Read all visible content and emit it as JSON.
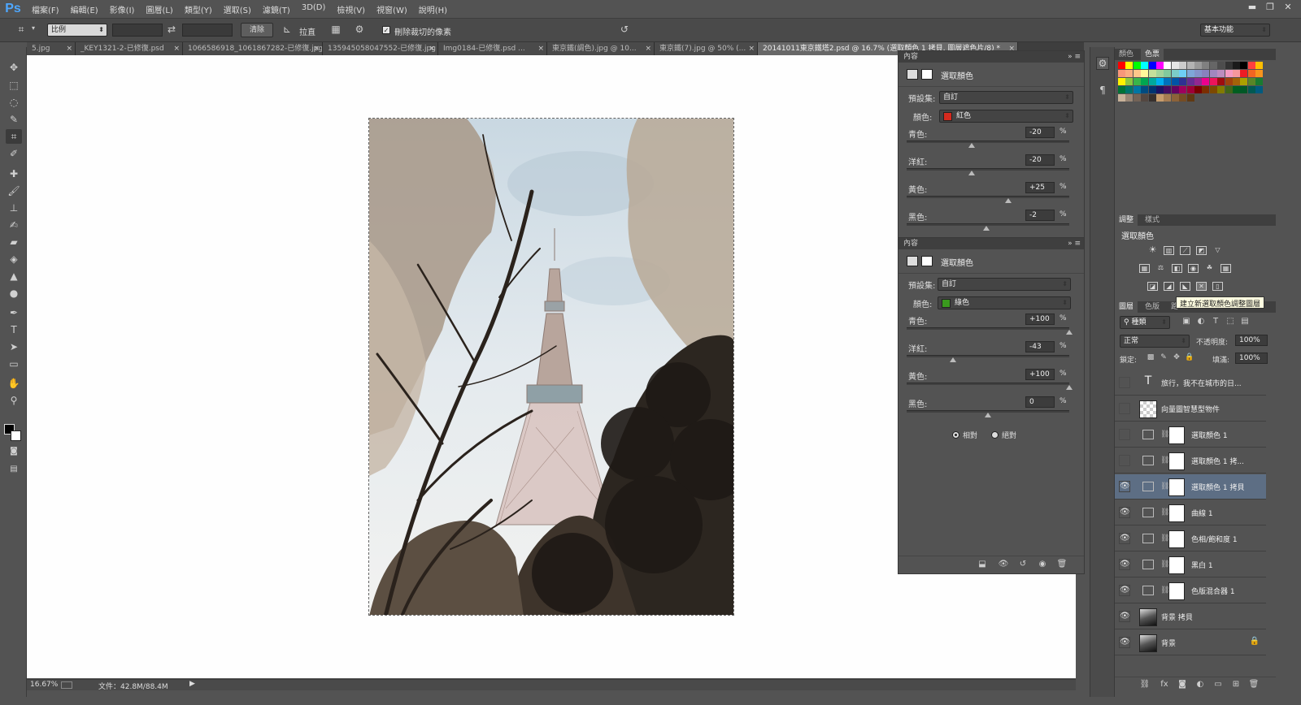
{
  "app": {
    "logo": "Ps"
  },
  "menu": [
    "檔案(F)",
    "編輯(E)",
    "影像(I)",
    "圖層(L)",
    "類型(Y)",
    "選取(S)",
    "濾鏡(T)",
    "3D(D)",
    "檢視(V)",
    "視窗(W)",
    "說明(H)"
  ],
  "window_controls": {
    "minimize": "▬",
    "restore": "❐",
    "close": "✕"
  },
  "options": {
    "ratio_select": "比例",
    "clear_button": "清除",
    "straighten_label": "拉直",
    "delete_cropped_label": "刪除裁切的像素",
    "delete_cropped_checked": "✓",
    "workspace": "基本功能"
  },
  "tabs": [
    {
      "label": "5.jpg"
    },
    {
      "label": "_KEY1321-2-已修復.psd"
    },
    {
      "label": "1066586918_1061867282-已修復.jpg"
    },
    {
      "label": "135945058047552-已修復.jpg"
    },
    {
      "label": "Img0184-已修復.psd ..."
    },
    {
      "label": "東京鐵(調色).jpg @ 10..."
    },
    {
      "label": "東京鐵(7).jpg @ 50% (..."
    },
    {
      "label": "20141011東京鐵塔2.psd @ 16.7% (選取顏色 1 拷貝, 圖層遮色片/8) *"
    }
  ],
  "tab_close": "×",
  "status": {
    "zoom": "16.67%",
    "doc": "文件：42.8M/88.4M"
  },
  "properties_top": {
    "header": "內容",
    "title": "選取顏色",
    "preset_label": "預設集:",
    "preset_value": "自訂",
    "colors_label": "顏色:",
    "colors_value": "紅色",
    "swatch_color": "#d42a1e",
    "sliders": [
      {
        "label": "青色:",
        "value": "-20",
        "unit": "%",
        "knob_pct": 0.4
      },
      {
        "label": "洋紅:",
        "value": "-20",
        "unit": "%",
        "knob_pct": 0.4
      },
      {
        "label": "黃色:",
        "value": "+25",
        "unit": "%",
        "knob_pct": 0.625
      },
      {
        "label": "黑色:",
        "value": "-2",
        "unit": "%",
        "knob_pct": 0.49
      }
    ]
  },
  "properties_bottom": {
    "header": "內容",
    "title": "選取顏色",
    "preset_label": "預設集:",
    "preset_value": "自訂",
    "colors_label": "顏色:",
    "colors_value": "綠色",
    "swatch_color": "#3a9a1e",
    "sliders": [
      {
        "label": "青色:",
        "value": "+100",
        "unit": "%",
        "knob_pct": 1.0
      },
      {
        "label": "洋紅:",
        "value": "-43",
        "unit": "%",
        "knob_pct": 0.285
      },
      {
        "label": "黃色:",
        "value": "+100",
        "unit": "%",
        "knob_pct": 1.0
      },
      {
        "label": "黑色:",
        "value": "0",
        "unit": "%",
        "knob_pct": 0.5
      }
    ],
    "radio_relative": "相對",
    "radio_absolute": "絕對"
  },
  "swatches_panel": {
    "tab1": "顏色",
    "tab2": "色票"
  },
  "adjustments_panel": {
    "tab1": "調整",
    "tab2": "樣式",
    "title": "選取顏色",
    "tooltip": "建立新選取顏色調整圖層"
  },
  "layers_panel": {
    "tab1": "圖層",
    "tab2": "色版",
    "tab3": "路",
    "filter_kind": "種類",
    "blend_mode": "正常",
    "opacity_label": "不透明度:",
    "opacity_value": "100%",
    "lock_label": "鎖定:",
    "fill_label": "填滿:",
    "fill_value": "100%",
    "layers": [
      {
        "name": "旅行，我不在城市的日...",
        "visible": false,
        "kind": "text"
      },
      {
        "name": "向量圖智慧型物件",
        "visible": false,
        "kind": "smart"
      },
      {
        "name": "選取顏色 1",
        "visible": false,
        "kind": "adj"
      },
      {
        "name": "選取顏色 1 拷...",
        "visible": false,
        "kind": "adj"
      },
      {
        "name": "選取顏色 1 拷貝",
        "visible": true,
        "kind": "adj",
        "selected": true
      },
      {
        "name": "曲線 1",
        "visible": true,
        "kind": "adj"
      },
      {
        "name": "色相/飽和度 1",
        "visible": true,
        "kind": "adj"
      },
      {
        "name": "黑白 1",
        "visible": true,
        "kind": "adj"
      },
      {
        "name": "色版混合器 1",
        "visible": true,
        "kind": "adj"
      },
      {
        "name": "背景 拷貝",
        "visible": true,
        "kind": "photo"
      },
      {
        "name": "背景",
        "visible": true,
        "kind": "photo",
        "locked": true
      }
    ]
  },
  "colors": {
    "accent_selection": "#5d6e84",
    "panel_bg": "#535353",
    "canvas_bg": "#fefefe"
  }
}
